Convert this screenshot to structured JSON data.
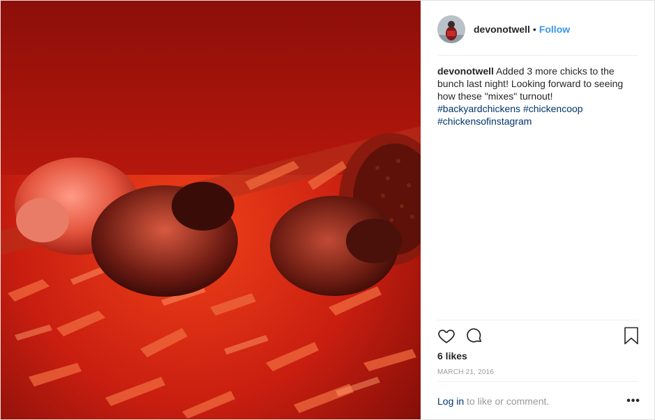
{
  "post": {
    "username": "devonotwell",
    "separator": "•",
    "follow_label": "Follow",
    "caption_username": "devonotwell",
    "caption_text": "Added 3 more chicks to the bunch last night! Looking forward to seeing how these \"mixes\" turnout!",
    "hashtags": [
      "#backyardchickens",
      "#chickencoop",
      "#chickensofinstagram"
    ],
    "likes": "6 likes",
    "date": "MARCH 21, 2016",
    "login_link": "Log in",
    "login_suffix": " to like or comment.",
    "more_options": "•••"
  },
  "icons": {
    "like": "heart-icon",
    "comment": "comment-icon",
    "save": "bookmark-icon",
    "more": "more-options-icon"
  },
  "colors": {
    "link_blue": "#3897f0",
    "hashtag": "#003569",
    "muted": "#999999",
    "photo_red": "#c2200f"
  }
}
